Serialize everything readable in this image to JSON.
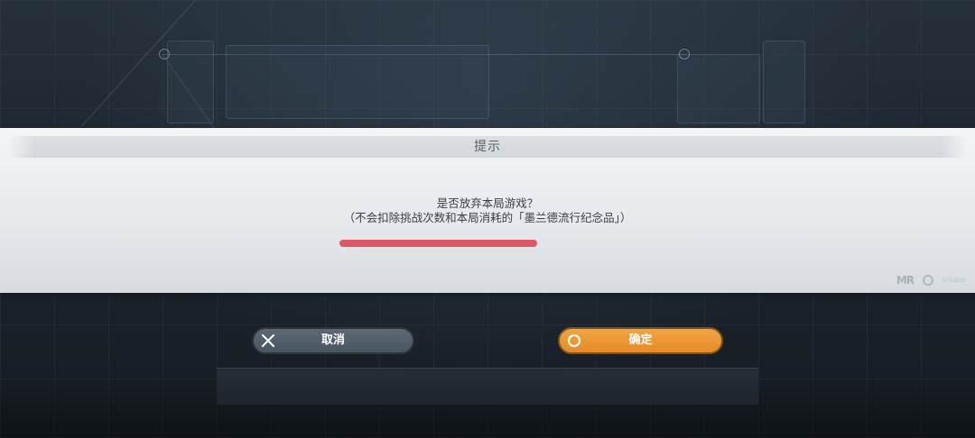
{
  "dialog": {
    "title": "提示",
    "message_line1": "是否放弃本局游戏？",
    "message_line2": "（不会扣除挑战次数和本局消耗的「墨兰德流行纪念品」）",
    "accent_color": "#de5764"
  },
  "buttons": {
    "cancel": {
      "label": "取消",
      "icon": "close-icon"
    },
    "confirm": {
      "label": "确定",
      "icon": "circle-icon"
    }
  },
  "logos": {
    "left": "MR",
    "right_icon": "studio-logo-icon",
    "right_text": "STUDIO"
  },
  "colors": {
    "cancel_button": "#55616c",
    "confirm_button": "#eb9a35",
    "dialog_background": "#eceef1"
  }
}
